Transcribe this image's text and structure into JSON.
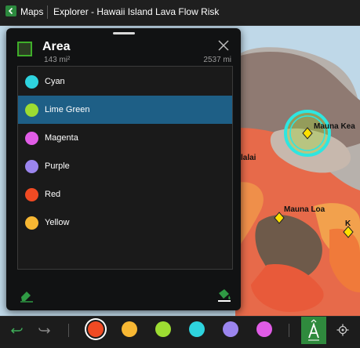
{
  "titlebar": {
    "back_label": "Maps",
    "title": "Explorer - Hawaii Island Lava Flow Risk"
  },
  "panel": {
    "title": "Area",
    "area_value": "143 mi²",
    "perimeter_value": "2537 mi",
    "colors": [
      {
        "label": "Cyan",
        "color": "#2ed3de",
        "selected": false
      },
      {
        "label": "Lime Green",
        "color": "#9ddc32",
        "selected": true
      },
      {
        "label": "Magenta",
        "color": "#e05ce6",
        "selected": false
      },
      {
        "label": "Purple",
        "color": "#9b85ee",
        "selected": false
      },
      {
        "label": "Red",
        "color": "#f04a23",
        "selected": false
      },
      {
        "label": "Yellow",
        "color": "#f7b733",
        "selected": false
      }
    ]
  },
  "map": {
    "labels": {
      "mauna_kea": "Mauna Kea",
      "mauna_loa": "Mauna Loa",
      "hualalai_partial": "lalai",
      "kilauea_partial": "K"
    }
  },
  "toolbar": {
    "swatches": [
      {
        "name": "red",
        "color": "#f04a23",
        "selected": true
      },
      {
        "name": "yellow",
        "color": "#f7b733",
        "selected": false
      },
      {
        "name": "lime-green",
        "color": "#9ddc32",
        "selected": false
      },
      {
        "name": "cyan",
        "color": "#2ed3de",
        "selected": false
      },
      {
        "name": "purple",
        "color": "#9b85ee",
        "selected": false
      },
      {
        "name": "magenta",
        "color": "#e05ce6",
        "selected": false
      }
    ],
    "accent": "#2f8a3d"
  }
}
